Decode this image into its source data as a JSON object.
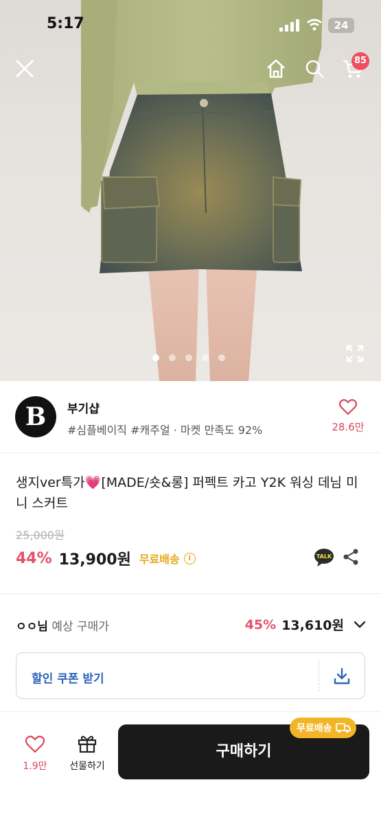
{
  "status_bar": {
    "time": "5:17",
    "battery": "24"
  },
  "header": {
    "cart_count": "85"
  },
  "gallery": {
    "total_images": 5,
    "current_index": 1
  },
  "shop": {
    "logo_letter": "B",
    "name": "부기샵",
    "tags": "#심플베이직 #캐주얼 · 마켓 만족도 92%",
    "like_count": "28.6만"
  },
  "product": {
    "title": "생지ver특가💗[MADE/숏&롱] 퍼펙트 카고 Y2K 워싱 데님 미니 스커트",
    "original_price": "25,000원",
    "discount": "44%",
    "price": "13,900원",
    "shipping": "무료배송",
    "info_icon": "i"
  },
  "talk_label": "TALK",
  "expected": {
    "user": "ㅇㅇ님",
    "label": " 예상 구매가",
    "discount": "45%",
    "price": "13,610원"
  },
  "coupon": {
    "label": "할인 쿠폰 받기"
  },
  "bottom_bar": {
    "like_count": "1.9만",
    "gift_label": "선물하기",
    "buy_label": "구매하기",
    "shipping_tag": "무료배송"
  },
  "colors": {
    "discount_pink": "#e4506a",
    "shipping_yellow": "#e6a817",
    "coupon_blue": "#2b63b9",
    "buy_black": "#1a1a1a",
    "badge_red": "#ef5060"
  }
}
